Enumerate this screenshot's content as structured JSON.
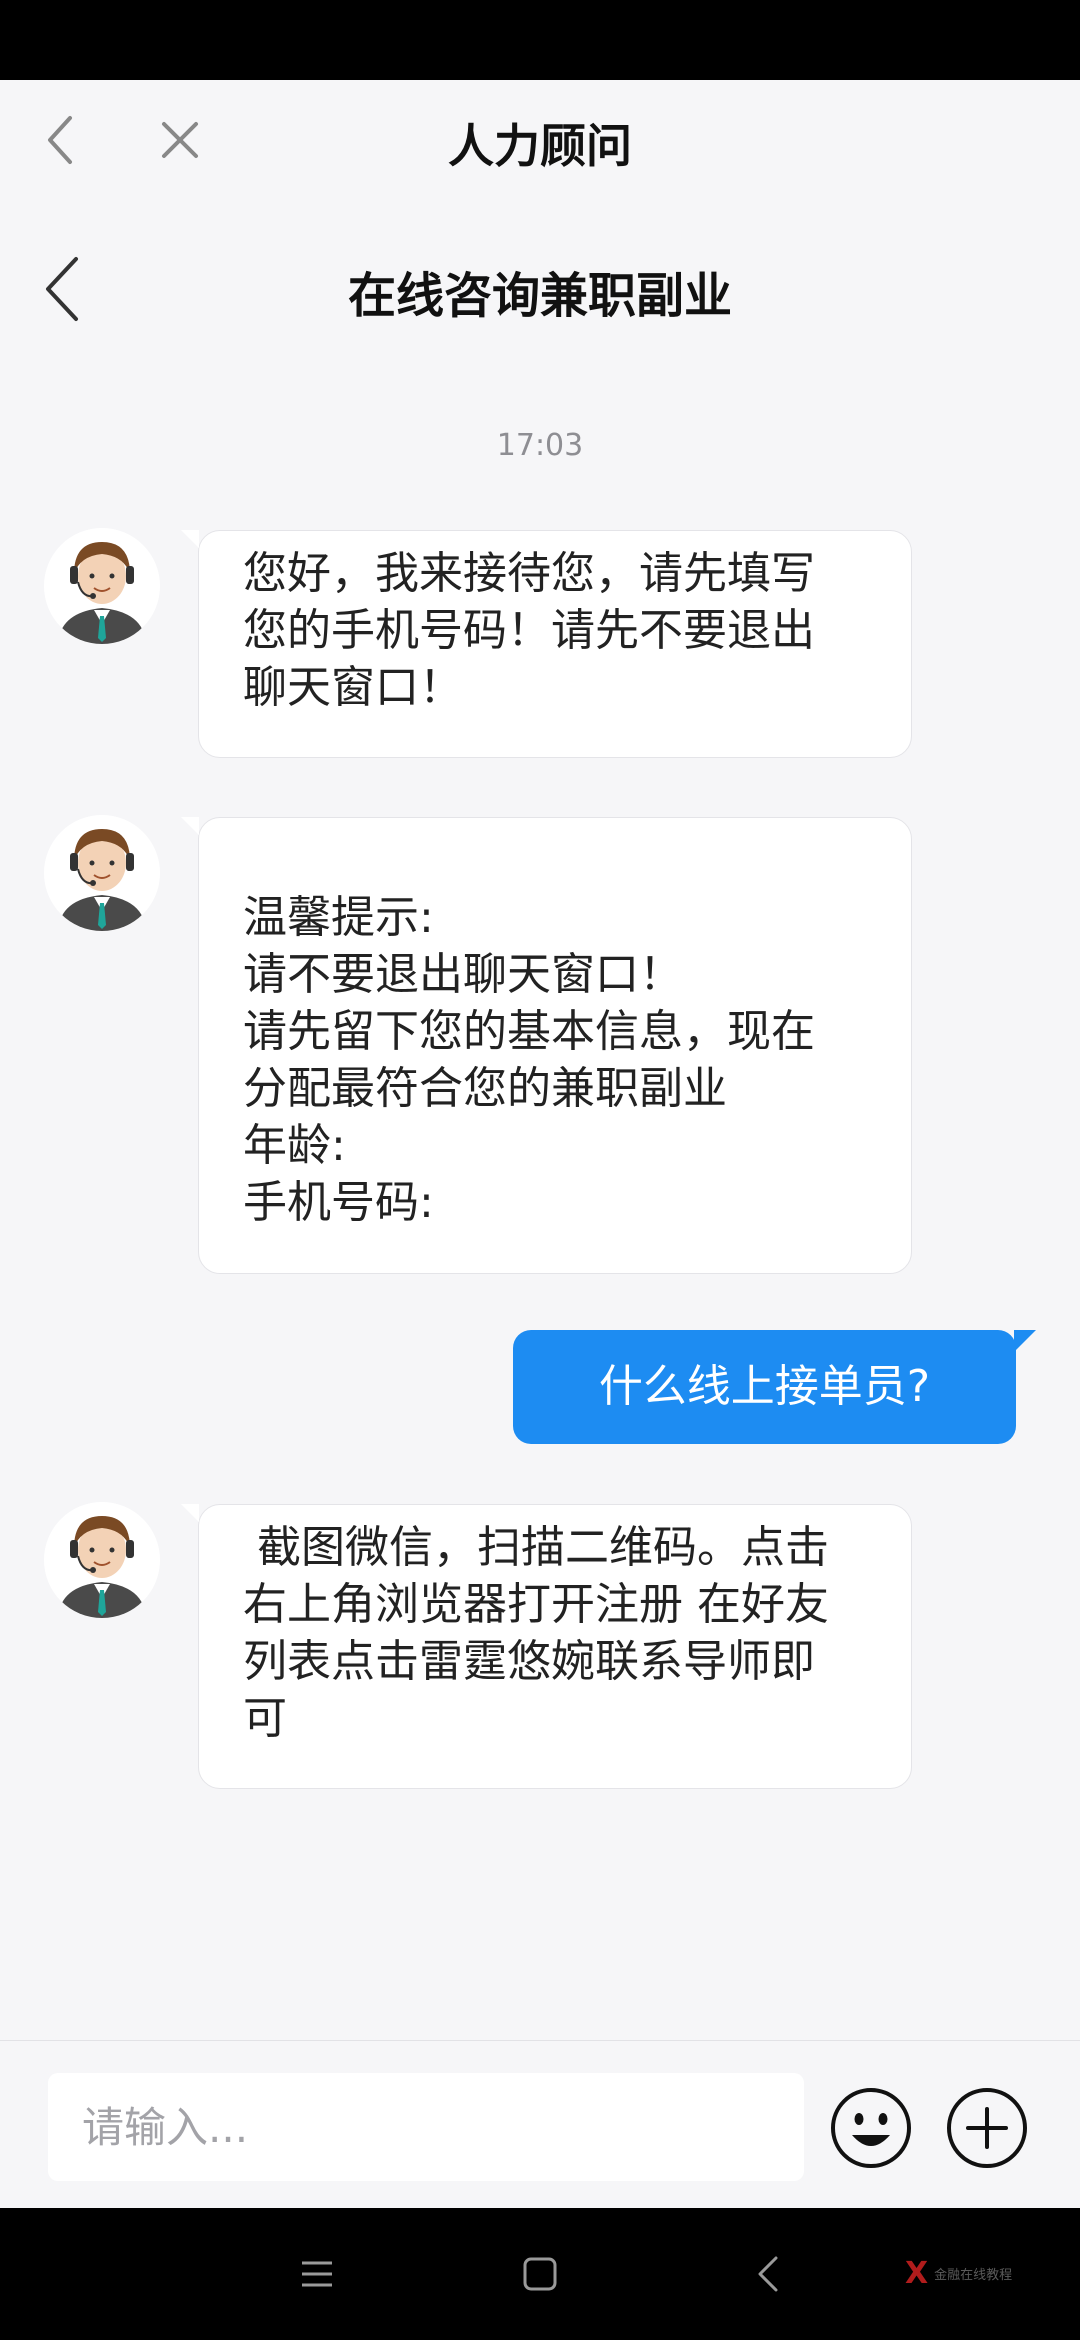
{
  "app_header": {
    "title": "人力顾问"
  },
  "chat_header": {
    "title": "在线咨询兼职副业"
  },
  "messages": [
    {
      "type": "timestamp",
      "text": "17:03"
    },
    {
      "type": "incoming",
      "text": "您好，我来接待您，请先填写\n您的手机号码！请先不要退出\n聊天窗口！"
    },
    {
      "type": "incoming",
      "text": "\n温馨提示:\n请不要退出聊天窗口！\n请先留下您的基本信息，现在\n分配最符合您的兼职副业\n年龄:\n手机号码:"
    },
    {
      "type": "outgoing",
      "text": "什么线上接单员?"
    },
    {
      "type": "incoming",
      "text": " 截图微信，扫描二维码。点击\n右上角浏览器打开注册 在好友\n列表点击雷霆悠婉联系导师即\n可"
    }
  ],
  "input": {
    "placeholder": "请输入..."
  },
  "icons": {
    "back": "chevron-left-icon",
    "close": "close-icon",
    "emoji": "smiley-face-icon",
    "more": "plus-circle-icon",
    "nav_menu": "menu-icon",
    "nav_home": "square-home-icon",
    "nav_back": "triangle-back-icon"
  },
  "colors": {
    "outgoing_bubble": "#1d8cf2",
    "background": "#f6f6f8",
    "watermark": "#b01c1c"
  },
  "watermark": {
    "mark": "X",
    "text": "金融在线教程"
  }
}
